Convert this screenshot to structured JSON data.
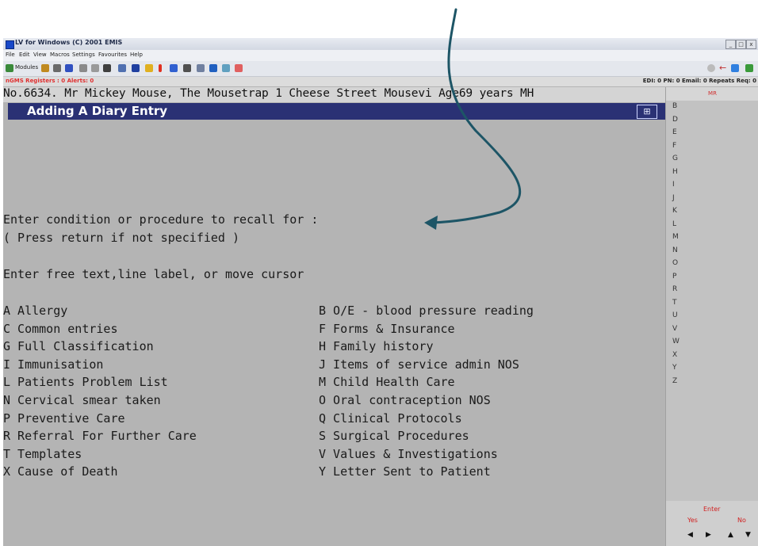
{
  "window": {
    "title": "LV for Windows (C) 2001 EMIS",
    "controls": [
      "_",
      "□",
      "x"
    ]
  },
  "menu": [
    "File",
    "Edit",
    "View",
    "Macros",
    "Settings",
    "Favourites",
    "Help"
  ],
  "toolbar": {
    "modules_label": "Modules"
  },
  "status": {
    "left": "nGMS Registers : 0  Alerts: 0",
    "right": "EDI: 0  PN: 0  Email: 0  Repeats Req: 0"
  },
  "patient": {
    "line": "No.6634. Mr Mickey Mouse, The Mousetrap 1 Cheese Street Mousevi   Age69 years MH"
  },
  "screen": {
    "title": "Adding A Diary Entry"
  },
  "prompt": {
    "line1": "Enter condition or procedure to recall for :",
    "line2": "( Press return if not specified )",
    "line3": "Enter free text,line label, or move cursor"
  },
  "options_left": [
    {
      "key": "A",
      "label": "Allergy"
    },
    {
      "key": "C",
      "label": "Common entries"
    },
    {
      "key": "G",
      "label": "Full Classification"
    },
    {
      "key": "I",
      "label": "Immunisation"
    },
    {
      "key": "L",
      "label": "Patients Problem List"
    },
    {
      "key": "N",
      "label": "Cervical smear taken"
    },
    {
      "key": "P",
      "label": "Preventive Care"
    },
    {
      "key": "R",
      "label": "Referral For Further Care"
    },
    {
      "key": "T",
      "label": "Templates"
    },
    {
      "key": "X",
      "label": "Cause of Death"
    }
  ],
  "options_right": [
    {
      "key": "B",
      "label": "O/E - blood pressure reading"
    },
    {
      "key": "F",
      "label": "Forms & Insurance"
    },
    {
      "key": "H",
      "label": "Family history"
    },
    {
      "key": "J",
      "label": "Items of service admin NOS"
    },
    {
      "key": "M",
      "label": "Child Health Care"
    },
    {
      "key": "O",
      "label": "Oral contraception NOS"
    },
    {
      "key": "Q",
      "label": "Clinical Protocols"
    },
    {
      "key": "S",
      "label": "Surgical Procedures"
    },
    {
      "key": "V",
      "label": "Values & Investigations"
    },
    {
      "key": "Y",
      "label": "Letter Sent to Patient"
    }
  ],
  "right_panel": {
    "header": "MR",
    "letters": [
      "B",
      "D",
      "E",
      "F",
      "G",
      "H",
      "I",
      "J",
      "K",
      "L",
      "M",
      "N",
      "O",
      "P",
      "R",
      "T",
      "U",
      "V",
      "W",
      "X",
      "Y",
      "Z"
    ],
    "enter": "Enter",
    "yes": "Yes",
    "no": "No"
  },
  "colors": {
    "header_bg": "#2a3174",
    "screen_bg": "#b4b4b4",
    "annotation_arrow": "#1d5566",
    "alert_red": "#e03030"
  },
  "icons": [
    "app-icon",
    "modules-icon",
    "back-arrow-icon",
    "annotation-arrow"
  ]
}
